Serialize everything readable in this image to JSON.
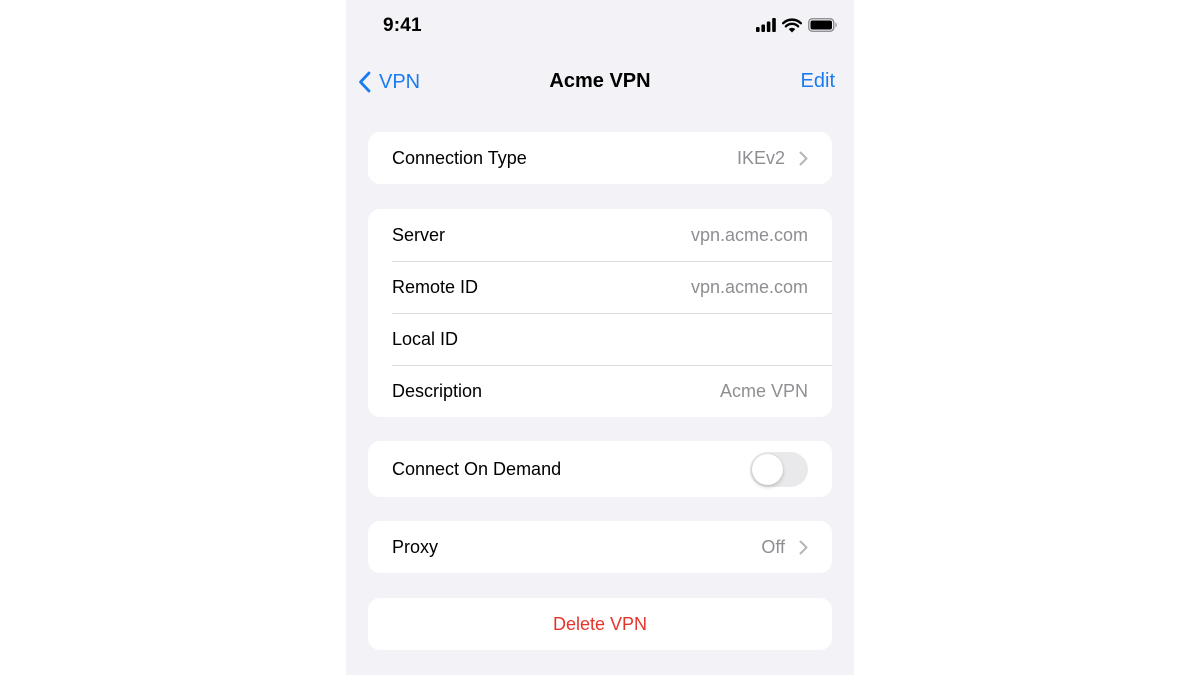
{
  "status_bar": {
    "time": "9:41",
    "icons": [
      "cellular-signal-icon",
      "wifi-icon",
      "battery-icon"
    ]
  },
  "nav": {
    "back_label": "VPN",
    "title": "Acme VPN",
    "edit_label": "Edit",
    "accent_color": "#1a7cf0"
  },
  "connection_group": {
    "connection_type": {
      "label": "Connection Type",
      "value": "IKEv2"
    }
  },
  "details_group": {
    "server": {
      "label": "Server",
      "value": "vpn.acme.com"
    },
    "remote_id": {
      "label": "Remote ID",
      "value": "vpn.acme.com"
    },
    "local_id": {
      "label": "Local ID",
      "value": ""
    },
    "description": {
      "label": "Description",
      "value": "Acme VPN"
    }
  },
  "on_demand_group": {
    "connect_on_demand": {
      "label": "Connect On Demand",
      "enabled": false
    }
  },
  "proxy_group": {
    "proxy": {
      "label": "Proxy",
      "value": "Off"
    }
  },
  "delete_group": {
    "delete_label": "Delete VPN",
    "destructive_color": "#e5352b"
  }
}
